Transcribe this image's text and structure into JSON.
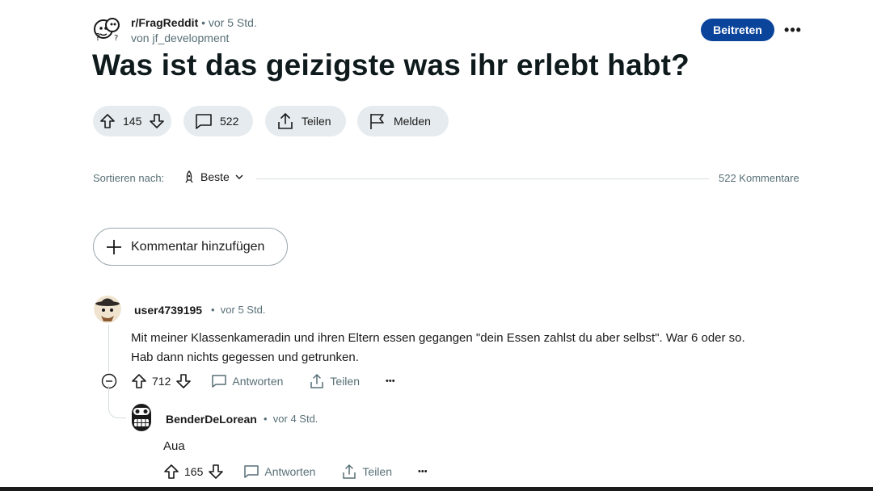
{
  "post": {
    "subreddit": "r/FragReddit",
    "time": "vor 5 Std.",
    "author_line": "von jf_development",
    "join_label": "Beitreten",
    "more_label": "•••",
    "title": "Was ist das geizigste was ihr erlebt habt?",
    "votes": "145",
    "comments": "522",
    "share_label": "Teilen",
    "report_label": "Melden"
  },
  "sort": {
    "label": "Sortieren nach:",
    "value": "Beste",
    "count_label": "522 Kommentare"
  },
  "add_comment_label": "Kommentar hinzufügen",
  "comments": [
    {
      "author": "user4739195",
      "time": "vor 5 Std.",
      "lines": [
        "Mit meiner Klassenkameradin und ihren Eltern essen gegangen \"dein Essen zahlst du aber selbst\". War 6 oder so.",
        "Hab dann nichts gegessen und getrunken."
      ],
      "votes": "712",
      "reply_label": "Antworten",
      "share_label": "Teilen",
      "more_label": "•••"
    },
    {
      "author": "BenderDeLorean",
      "time": "vor 4 Std.",
      "lines": [
        "Aua"
      ],
      "votes": "165",
      "reply_label": "Antworten",
      "share_label": "Teilen",
      "more_label": "•••"
    }
  ],
  "colors": {
    "join_button": "#0a449b",
    "pill_background": "#e5ebee",
    "meta_text": "#576f76"
  }
}
